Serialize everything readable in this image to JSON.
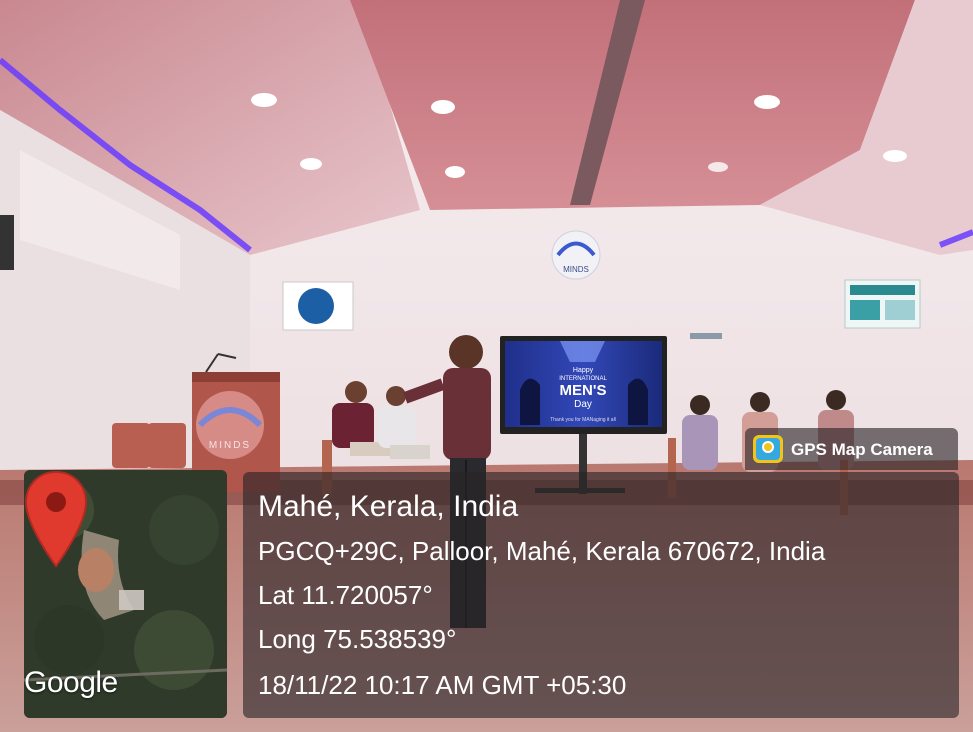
{
  "photo": {
    "podium_text": "MINDS",
    "wall_logo_text": "MINDS",
    "screen_text": {
      "line1": "Happy",
      "line2": "INTERNATIONAL",
      "line3": "MEN'S",
      "line4": "Day",
      "footer": "Thank you for MANaging it all"
    }
  },
  "overlay": {
    "app_badge": "GPS Map Camera",
    "map_brand": "Google",
    "place_name": "Mahé, Kerala, India",
    "address": "PGCQ+29C, Palloor, Mahé, Kerala 670672, India",
    "latitude": "Lat 11.720057°",
    "longitude": "Long 75.538539°",
    "datetime": "18/11/22 10:17 AM GMT +05:30"
  },
  "colors": {
    "ceiling": "#d8a0a8",
    "wall": "#f3e7ea",
    "floor": "#9a5a56",
    "purple_light": "#6a3cff",
    "podium": "#b55a4e",
    "pin": "#e03a2f"
  }
}
